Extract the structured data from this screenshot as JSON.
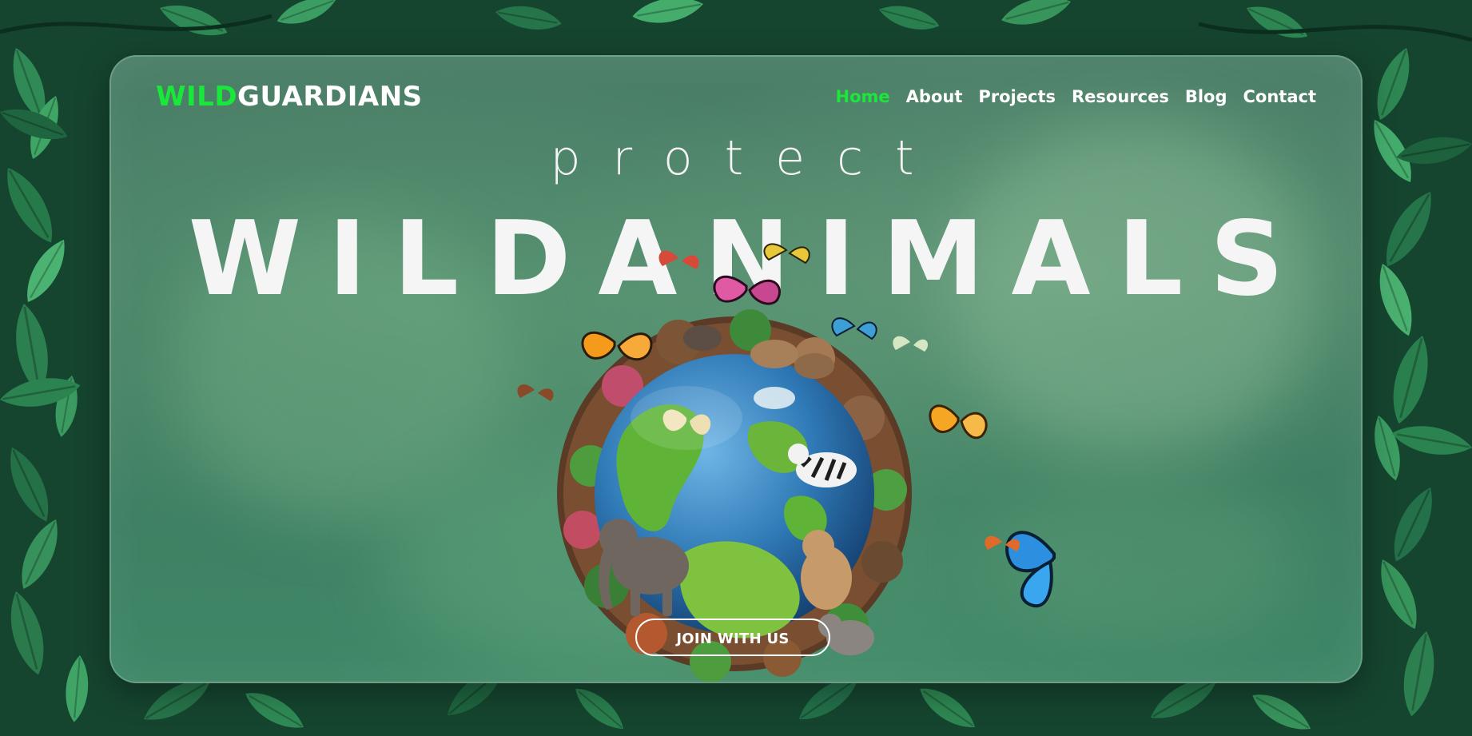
{
  "brand": {
    "logo_part1": "WILD",
    "logo_part2": "GUARDIANS",
    "accent_color": "#19e83a"
  },
  "nav": {
    "items": [
      {
        "label": "Home",
        "active": true
      },
      {
        "label": "About",
        "active": false
      },
      {
        "label": "Projects",
        "active": false
      },
      {
        "label": "Resources",
        "active": false
      },
      {
        "label": "Blog",
        "active": false
      },
      {
        "label": "Contact",
        "active": false
      }
    ]
  },
  "hero": {
    "subtitle": "protect",
    "headline": "WILDANIMALS",
    "cta_label": "JOIN WITH US",
    "image": "globe-with-wildlife-and-butterflies"
  },
  "colors": {
    "background": "#1c5a40",
    "text": "#ffffff"
  }
}
